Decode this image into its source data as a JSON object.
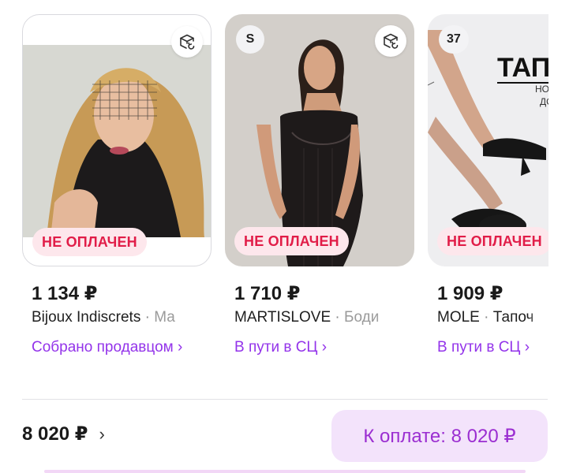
{
  "colors": {
    "accent": "#9333ea",
    "status_bg": "#fde7ec",
    "status_text": "#e11d48",
    "pay_bg": "#f3e3fb",
    "pay_text": "#9b2ed1"
  },
  "cards": [
    {
      "status": "НЕ ОПЛАЧЕН",
      "price": "1 134 ₽",
      "brand": "Bijoux Indiscrets",
      "separator": " · ",
      "name": "Ма",
      "delivery": "Собрано продавцом ›",
      "top_icon": "return-box-icon",
      "photo": "woman-with-lace-veil"
    },
    {
      "chip": "S",
      "status": "НЕ ОПЛАЧЕН",
      "price": "1 710 ₽",
      "brand": "MARTISLOVE",
      "separator": " · ",
      "name": "Боди",
      "delivery": "В пути в СЦ ›",
      "top_icon": "return-box-icon",
      "photo": "woman-in-black-bodysuit"
    },
    {
      "chip": "37",
      "status": "НЕ ОПЛАЧЕН",
      "price": "1 909 ₽",
      "brand": "MOLE",
      "separator": " · ",
      "name": "Тапоч",
      "delivery": "В пути в СЦ ›",
      "photo": "feet-in-heeled-slippers",
      "photo_text": {
        "headline": "ТАПО",
        "line1": "НО",
        "line2": "ДО"
      }
    }
  ],
  "footer": {
    "total": "8 020 ₽",
    "total_chevron": "›",
    "pay_button": "К оплате: 8 020 ₽"
  }
}
